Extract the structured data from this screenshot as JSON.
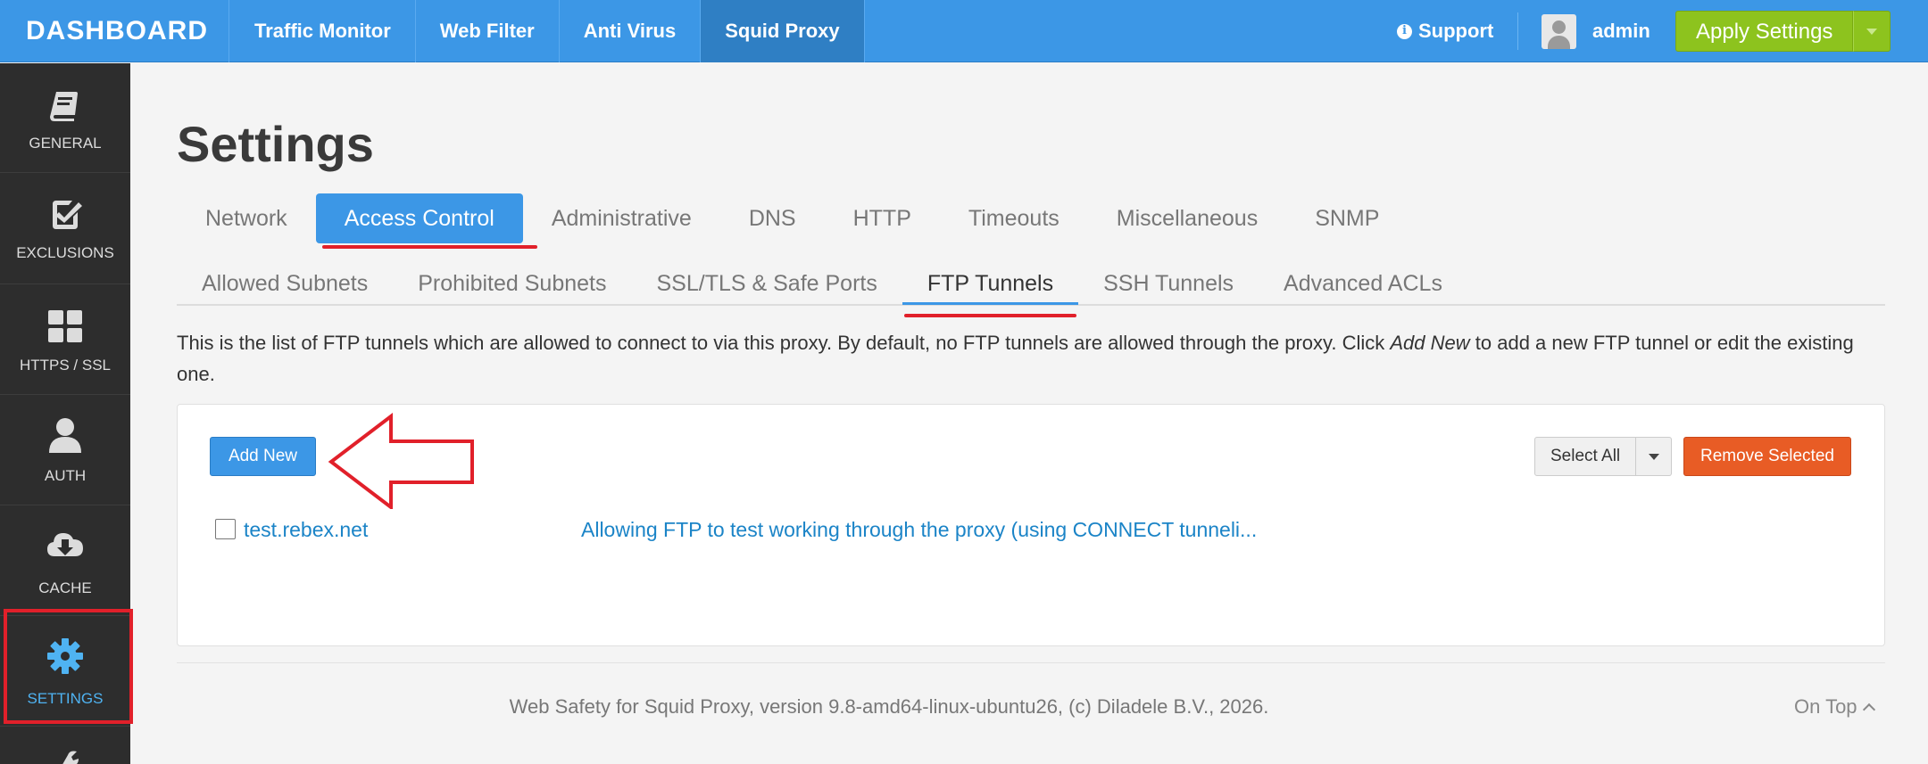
{
  "topbar": {
    "brand": "DASHBOARD",
    "tabs": [
      "Traffic Monitor",
      "Web Filter",
      "Anti Virus",
      "Squid Proxy"
    ],
    "support": "Support",
    "user": "admin",
    "apply": "Apply Settings"
  },
  "sidebar": {
    "items": [
      {
        "label": "GENERAL",
        "icon": "book-icon"
      },
      {
        "label": "EXCLUSIONS",
        "icon": "checkbox-icon"
      },
      {
        "label": "HTTPS / SSL",
        "icon": "grid-icon"
      },
      {
        "label": "AUTH",
        "icon": "user-icon"
      },
      {
        "label": "CACHE",
        "icon": "cloud-download-icon"
      },
      {
        "label": "SETTINGS",
        "icon": "gear-icon"
      }
    ],
    "active_color": "#4fb3f2"
  },
  "page": {
    "title": "Settings",
    "tabs": [
      "Network",
      "Access Control",
      "Administrative",
      "DNS",
      "HTTP",
      "Timeouts",
      "Miscellaneous",
      "SNMP"
    ],
    "subtabs": [
      "Allowed Subnets",
      "Prohibited Subnets",
      "SSL/TLS & Safe Ports",
      "FTP Tunnels",
      "SSH Tunnels",
      "Advanced ACLs"
    ],
    "desc_before": "This is the list of FTP tunnels which are allowed to connect to via this proxy. By default, no FTP tunnels are allowed through the proxy. Click ",
    "desc_em": "Add New",
    "desc_after": " to add a new FTP tunnel or edit the existing one."
  },
  "panel": {
    "add_new": "Add New",
    "select_all": "Select All",
    "remove_selected": "Remove Selected",
    "rows": [
      {
        "name": "test.rebex.net",
        "description": "Allowing FTP to test working through the proxy (using CONNECT tunneli..."
      }
    ]
  },
  "footer": {
    "text": "Web Safety for Squid Proxy, version 9.8-amd64-linux-ubuntu26, (c) Diladele B.V., 2026.",
    "on_top": "On Top"
  }
}
